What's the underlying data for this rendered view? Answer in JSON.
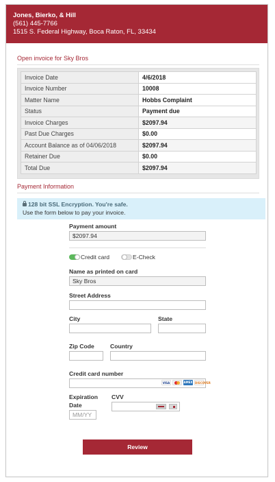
{
  "firm": {
    "name": "Jones, Bierko, & Hill",
    "phone": "(561) 445-7766",
    "address": "1515 S. Federal Highway, Boca Raton, FL, 33434"
  },
  "invoice_section": {
    "title": "Open invoice for Sky Bros",
    "rows": [
      {
        "label": "Invoice Date",
        "value": "4/6/2018"
      },
      {
        "label": "Invoice Number",
        "value": "10008"
      },
      {
        "label": "Matter Name",
        "value": "Hobbs Complaint"
      },
      {
        "label": "Status",
        "value": "Payment due"
      },
      {
        "label": "Invoice Charges",
        "value": "$2097.94"
      },
      {
        "label": "Past Due Charges",
        "value": "$0.00"
      },
      {
        "label": "Account Balance as of 04/06/2018",
        "value": "$2097.94"
      },
      {
        "label": "Retainer Due",
        "value": "$0.00"
      },
      {
        "label": "Total Due",
        "value": "$2097.94"
      }
    ]
  },
  "payment_section": {
    "title": "Payment Information",
    "secure_title": "128 bit SSL Encryption. You're safe.",
    "secure_sub": "Use the form below to pay your invoice."
  },
  "form": {
    "payment_amount_label": "Payment amount",
    "payment_amount_value": "$2097.94",
    "method_credit": "Credit card",
    "method_echeck": "E-Check",
    "selected_method": "Credit card",
    "name_label": "Name as printed on card",
    "name_value": "Sky Bros",
    "street_label": "Street Address",
    "street_value": "",
    "city_label": "City",
    "city_value": "",
    "state_label": "State",
    "state_value": "",
    "zip_label": "Zip Code",
    "zip_value": "",
    "country_label": "Country",
    "country_value": "",
    "card_label": "Credit card number",
    "card_value": "",
    "card_logos": [
      "VISA",
      "MC",
      "AMEX",
      "DISCOVER"
    ],
    "exp_label_1": "Expiration",
    "exp_label_2": "Date",
    "exp_placeholder": "MM/YY",
    "cvv_label": "CVV",
    "cvv_value": "",
    "review_label": "Review"
  },
  "colors": {
    "brand": "#a52835",
    "secure_bg": "#d9f0fa",
    "toggle_on": "#5cb85c"
  }
}
